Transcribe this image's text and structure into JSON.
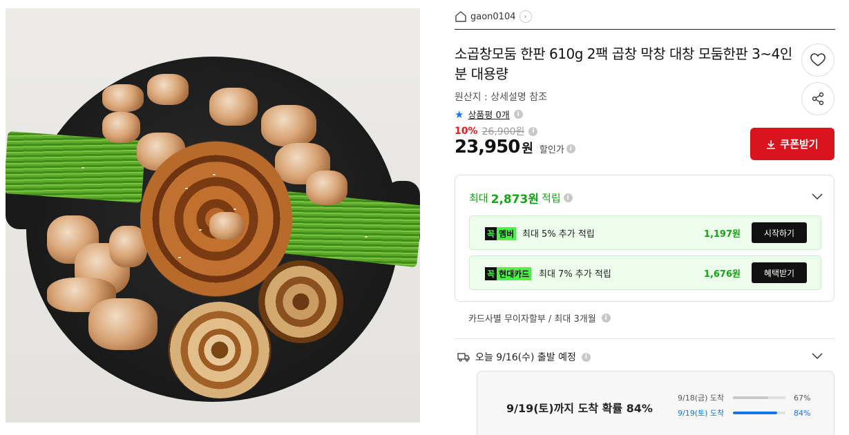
{
  "shop": {
    "name": "gaon0104",
    "home_icon": "home-icon",
    "chevron_icon": "chevron-right-icon"
  },
  "product": {
    "title": "소곱창모둠 한판 610g 2팩 곱창 막창 대창 모둠한판 3~4인분 대용량",
    "origin": "원산지 : 상세설명 참조",
    "review_label": "상품평 0개",
    "discount_rate": "10%",
    "original_price": "26,900원",
    "price": "23,950",
    "price_unit": "원",
    "price_label": "할인가"
  },
  "actions": {
    "coupon_label": "쿠폰받기",
    "like_icon": "heart-icon",
    "share_icon": "share-icon"
  },
  "points": {
    "prefix": "최대",
    "amount": "2,873원",
    "suffix": "적립",
    "promos": [
      {
        "badge_a": "꼭",
        "badge_b": "멤버",
        "desc": "최대 5% 추가 적립",
        "amount": "1,197원",
        "action": "시작하기"
      },
      {
        "badge_a": "꼭",
        "badge_b": "현대카드",
        "desc": "최대 7% 추가 적립",
        "amount": "1,676원",
        "action": "혜택받기"
      }
    ]
  },
  "installment": "카드사별 무이자할부 / 최대 3개월",
  "shipping": {
    "text": "오늘 9/16(수) 출발 예정",
    "eta_main": "9/19(토)까지 도착 확률 84%",
    "rows": [
      {
        "date": "9/18(금) 도착",
        "pct": "67%",
        "value": 67
      },
      {
        "date": "9/19(토) 도착",
        "pct": "84%",
        "value": 84
      }
    ]
  },
  "colors": {
    "accent_red": "#d9141e",
    "point_green": "#16a316",
    "eta_blue": "#1a73e8"
  }
}
